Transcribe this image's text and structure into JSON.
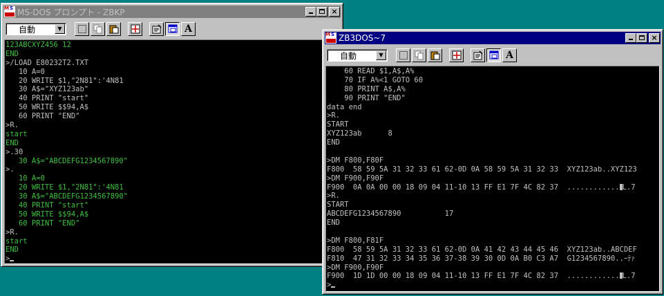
{
  "window_left": {
    "title": "MS-DOS プロンプト - ZBKP",
    "font_value": "自動",
    "lines": [
      {
        "t": "123ABCXYZ456 12",
        "c": "g"
      },
      {
        "t": "END",
        "c": "g"
      },
      {
        "t": ">/LOAD E80232T2.TXT",
        "c": "w"
      },
      {
        "t": "   10 A=0",
        "c": "w"
      },
      {
        "t": "   20 WRITE $1,\"2N81\":'4N81",
        "c": "w"
      },
      {
        "t": "   30 A$=\"XYZ123ab\"",
        "c": "w"
      },
      {
        "t": "   40 PRINT \"start\"",
        "c": "w"
      },
      {
        "t": "   50 WRITE $$94,A$",
        "c": "w"
      },
      {
        "t": "   60 PRINT \"END\"",
        "c": "w"
      },
      {
        "t": ">R.",
        "c": "w"
      },
      {
        "t": "start",
        "c": "g"
      },
      {
        "t": "END",
        "c": "g"
      },
      {
        "t": ">.30",
        "c": "w"
      },
      {
        "t": "   30 A$=\"ABCDEFG1234567890\"",
        "c": "g"
      },
      {
        "t": ">.",
        "c": "w"
      },
      {
        "t": "   10 A=0",
        "c": "g"
      },
      {
        "t": "   20 WRITE $1,\"2N81\":'4N81",
        "c": "g"
      },
      {
        "t": "   30 A$=\"ABCDEFG1234567890\"",
        "c": "g"
      },
      {
        "t": "   40 PRINT \"start\"",
        "c": "g"
      },
      {
        "t": "   50 WRITE $$94,A$",
        "c": "g"
      },
      {
        "t": "   60 PRINT \"END\"",
        "c": "g"
      },
      {
        "t": ">R.",
        "c": "w"
      },
      {
        "t": "start",
        "c": "g"
      },
      {
        "t": "END",
        "c": "g"
      },
      {
        "t": ">",
        "c": "w"
      }
    ]
  },
  "window_right": {
    "title": "ZB3DOS~7",
    "font_value": "自動",
    "lines": [
      {
        "t": "    60 READ $1,A$,A%",
        "c": "w"
      },
      {
        "t": "    70 IF A%<1 GOTO 60",
        "c": "w"
      },
      {
        "t": "    80 PRINT A$,A%",
        "c": "w"
      },
      {
        "t": "    90 PRINT \"END\"",
        "c": "w"
      },
      {
        "t": "data end",
        "c": "w"
      },
      {
        "t": ">R.",
        "c": "w"
      },
      {
        "t": "START",
        "c": "w"
      },
      {
        "t": "XYZ123ab      8",
        "c": "w"
      },
      {
        "t": "END",
        "c": "w"
      },
      {
        "t": "",
        "c": "w"
      },
      {
        "t": ">DM F800,F80F",
        "c": "w"
      },
      {
        "t": "F800  58 59 5A 31 32 33 61 62-0D 0A 58 59 5A 31 32 33  XYZ123ab..XYZ123",
        "c": "w"
      },
      {
        "t": ">DM F900,F90F",
        "c": "w"
      },
      {
        "t": "F900  0A 0A 00 00 18 09 04 11-10 13 FF E1 7F 4C 82 37  ............",
        "c": "w",
        "tail": "L.7"
      },
      {
        "t": ">R.",
        "c": "w"
      },
      {
        "t": "START",
        "c": "w"
      },
      {
        "t": "ABCDEFG1234567890          17",
        "c": "w"
      },
      {
        "t": "END",
        "c": "w"
      },
      {
        "t": "",
        "c": "w"
      },
      {
        "t": ">DM F800,F81F",
        "c": "w"
      },
      {
        "t": "F800  58 59 5A 31 32 33 61 62-0D 0A 41 42 43 44 45 46  XYZ123ab..ABCDEF",
        "c": "w"
      },
      {
        "t": "F810  47 31 32 33 34 35 36 37-38 39 30 0D 0A B0 C3 A7  G1234567890..ｰﾃｧ",
        "c": "w"
      },
      {
        "t": ">DM F900,F90F",
        "c": "w"
      },
      {
        "t": "F900  1D 1D 00 00 18 09 04 11-10 13 FF E1 7F 4C 82 37  ............",
        "c": "w",
        "tail": "L.7"
      },
      {
        "t": ">",
        "c": "w"
      }
    ]
  },
  "icons": {
    "minimize": "minimize-icon",
    "maximize": "maximize-icon",
    "close_glyph": "×",
    "font_glyph": "A"
  }
}
